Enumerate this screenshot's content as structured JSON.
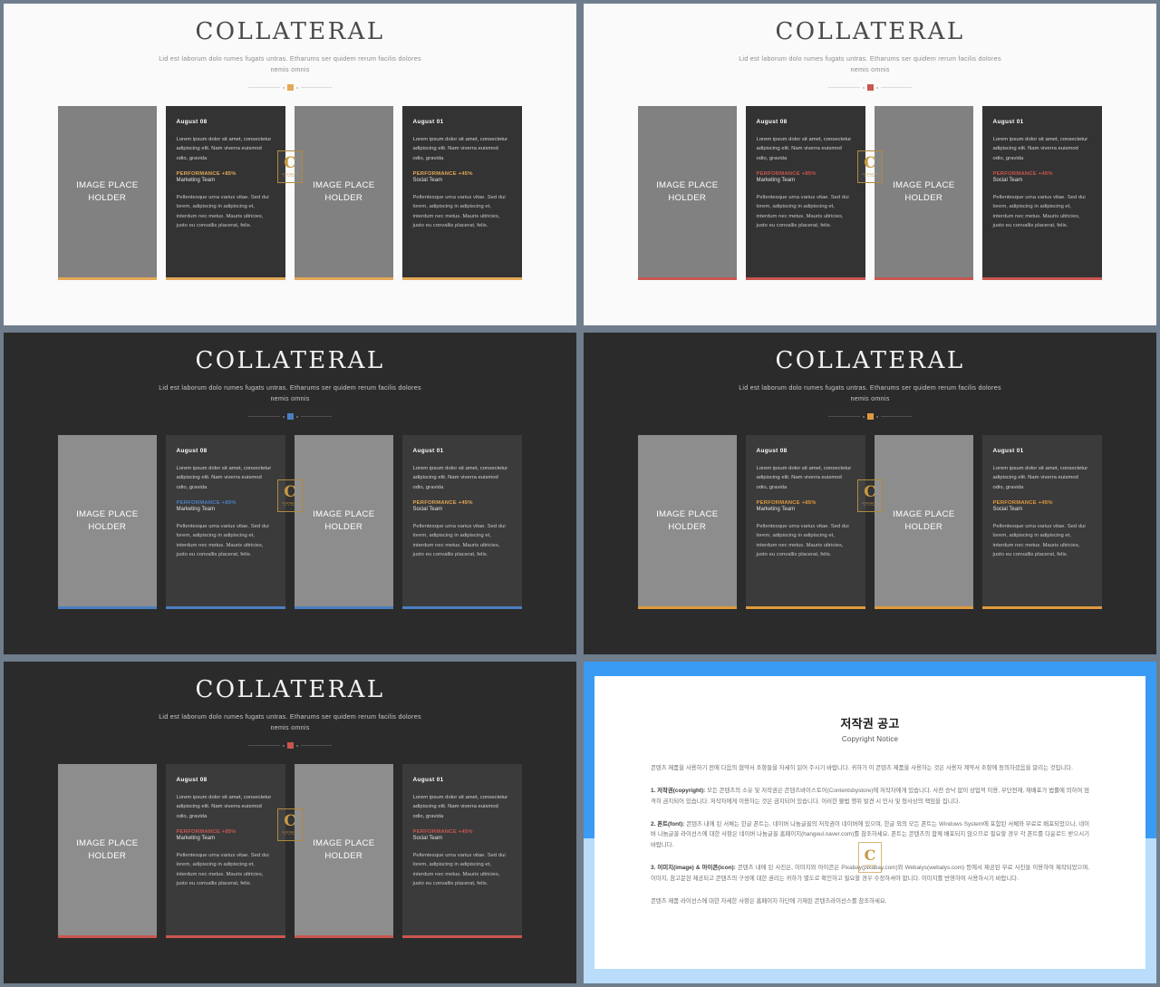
{
  "deck": {
    "title": "COLLATERAL",
    "subtitle": "Lid est laborum dolo rumes fugats untras. Etharums ser quidem rerum facilis dolores nemis omnis",
    "image_placeholder": "IMAGE PLACE\nHOLDER",
    "logo": {
      "letter": "C",
      "wordmark": "CONTENTS",
      "tagline": "BY STORE"
    }
  },
  "cards": {
    "left": {
      "date": "August 08",
      "lead": "Lorem ipsum dolor sit amet, consectetur adipiscing elit. Nam viverra euismod odio, gravida",
      "performance": "PERFORMANCE +85%",
      "team": "Marketing Team",
      "body": "Pellentesque urna varius vitae. Sed dui lorem, adipiscing in adipiscing et, interdum nec metus. Mauris ultricies, justo eu convallis placerat, felis."
    },
    "right": {
      "date": "August 01",
      "lead": "Lorem ipsum dolor sit amet, consectetur adipiscing elit. Nam viverra euismod odio, gravida",
      "performance": "PERFORMANCE +45%",
      "team": "Social Team",
      "body": "Pellentesque urna varius vitae. Sed dui lorem, adipiscing in adipiscing et, interdum nec metus. Mauris ultricies, justo eu convallis placerat, felis."
    }
  },
  "panels": [
    {
      "id": "panel-light-orange",
      "theme": "light",
      "accent": "#e2a857",
      "divider_accent": "#e2a857"
    },
    {
      "id": "panel-light-red",
      "theme": "light",
      "accent": "#c9564f",
      "divider_accent": "#c9564f"
    },
    {
      "id": "panel-dark-blue",
      "theme": "dark",
      "accent": "#4a7fc1",
      "divider_accent": "#4a7fc1"
    },
    {
      "id": "panel-dark-orange",
      "theme": "dark",
      "accent": "#e09a3c",
      "divider_accent": "#e09a3c"
    },
    {
      "id": "panel-dark-red",
      "theme": "dark",
      "accent": "#c9564f",
      "divider_accent": "#c9564f"
    }
  ],
  "copyright": {
    "title": "저작권 공고",
    "subtitle": "Copyright Notice",
    "intro": "콘텐츠 제품을 사용하기 전에 다음의 협약서 조항들을 자세히 읽어 주시기 바랍니다. 귀하가 이 콘텐츠 제품을 사용하는 것은 사용자 계약서 조항에 동의하셨음을 알리는 것입니다.",
    "items": [
      {
        "label": "1. 저작권(copyright):",
        "text": " 모든 콘텐츠의 소유 및 저작권은 콘텐츠바이스토어(Contentsbystore)에 저작자에게 있습니다. 사전 승낙 없이 상업적 이용, 무단전재, 재배포가 법률에 의하여 엄격히 금지되어 있습니다. 저작자에게 이용하는 것은 금지되어 있습니다. 이러한 불법 행위 발견 시 민사 및 형사상의 책임을 집니다."
      },
      {
        "label": "2. 폰트(font):",
        "text": " 콘텐츠 내에 된 서체는 한글 폰트는, 네이버 나눔글꼴의 저작권이 네이버에 있으며, 한글 외의 모든 폰트는 Windows System에 포함된 서체와 무료로 배포되었으나, 네이버 나눔글꼴 라이선스에 대한 사항은 네이버 나눔글꼴 홈페이지(hangeul.naver.com)를 참조하세요. 폰트는 콘텐츠의 함께 배포되지 않으므로 필요할 경우 각 폰트를 다운로드 받으시기 바랍니다."
      },
      {
        "label": "3. 이미지(image) & 아이콘(icon):",
        "text": " 콘텐츠 내에 된 사진은, 이미지와 아이콘은 Pixabay(pixabay.com)와 Webalys(webalys.com) 등에서 제공된 무료 사진들 이용하여 제작되었으며, 이미지, 참고문헌 제공되고 콘텐츠의 구성에 대한 권리는 귀하가 별도로 확인하고 필요할 경우 수정하셔야 합니다. 이미지를 반영하여 사용하시기 바랍니다."
      }
    ],
    "footer": "콘텐츠 제품 라이선스에 대한 자세한 사항은 홈페이지 하단에 기재된 콘텐츠라이선스를 참조하세요."
  }
}
